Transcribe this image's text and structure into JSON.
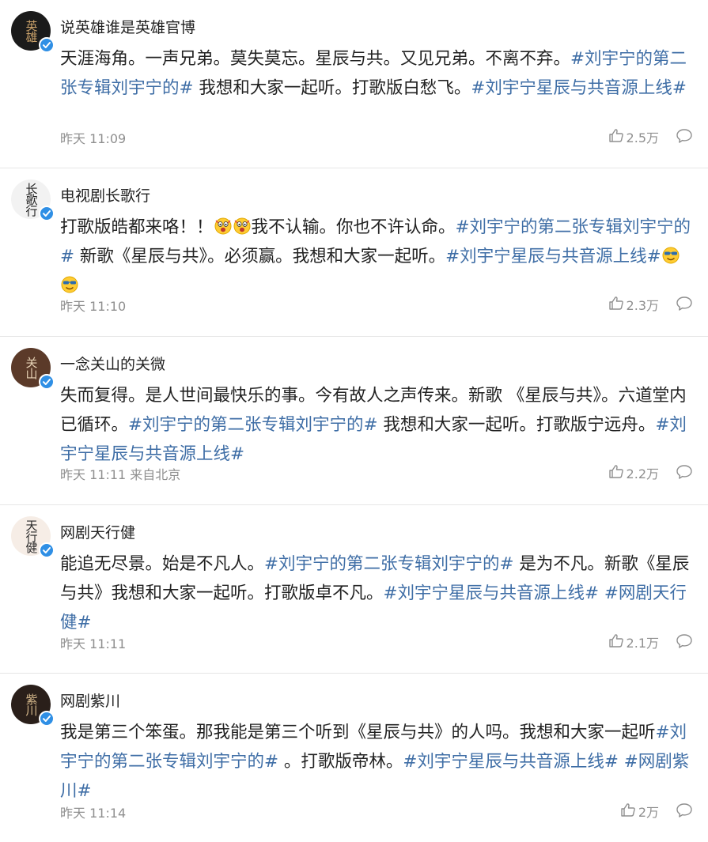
{
  "colors": {
    "hashtag": "#3f6ea6",
    "meta": "#8f8f8f",
    "verified_badge": "#2f8fe5",
    "divider": "#e6e6e6"
  },
  "posts": [
    {
      "username": "说英雄谁是英雄官博",
      "avatar_text": "英雄",
      "avatar_bg": "#1b1b1b",
      "avatar_fg": "#c9a16a",
      "verified": true,
      "content": [
        {
          "type": "text",
          "value": "天涯海角。一声兄弟。莫失莫忘。星辰与共。又见兄弟。不离不弃。"
        },
        {
          "type": "tag",
          "value": "#刘宇宁的第二张专辑刘宇宁的#"
        },
        {
          "type": "text",
          "value": " 我想和大家一起听。打歌版白愁飞。"
        },
        {
          "type": "tag",
          "value": "#刘宇宁星辰与共音源上线#"
        }
      ],
      "time": "昨天 11:09",
      "location": "",
      "likes": "2.5万",
      "icons": {
        "like": "thumbs-up-icon",
        "comment": "comment-icon"
      }
    },
    {
      "username": "电视剧长歌行",
      "avatar_text": "长歌行",
      "avatar_bg": "#f2f2f2",
      "avatar_fg": "#222222",
      "verified": true,
      "content": [
        {
          "type": "text",
          "value": "打歌版皓都来咯！！"
        },
        {
          "type": "emoji",
          "value": "shocked-emoji"
        },
        {
          "type": "emoji",
          "value": "shocked-emoji"
        },
        {
          "type": "text",
          "value": "我不认输。你也不许认命。"
        },
        {
          "type": "tag",
          "value": "#刘宇宁的第二张专辑刘宇宁的#"
        },
        {
          "type": "text",
          "value": " 新歌《星辰与共》。必须赢。我想和大家一起听。"
        },
        {
          "type": "tag",
          "value": "#刘宇宁星辰与共音源上线#"
        },
        {
          "type": "emoji",
          "value": "cool-emoji"
        },
        {
          "type": "emoji",
          "value": "cool-emoji"
        }
      ],
      "time": "昨天 11:10",
      "location": "",
      "likes": "2.3万",
      "icons": {
        "like": "thumbs-up-icon",
        "comment": "comment-icon"
      }
    },
    {
      "username": "一念关山的关微",
      "avatar_text": "关山",
      "avatar_bg": "#5b3a29",
      "avatar_fg": "#e7d2b5",
      "verified": true,
      "content": [
        {
          "type": "text",
          "value": "失而复得。是人世间最快乐的事。今有故人之声传来。新歌 《星辰与共》。六道堂内已循环。"
        },
        {
          "type": "tag",
          "value": "#刘宇宁的第二张专辑刘宇宁的#"
        },
        {
          "type": "text",
          "value": " 我想和大家一起听。打歌版宁远舟。"
        },
        {
          "type": "tag",
          "value": "#刘宇宁星辰与共音源上线#"
        }
      ],
      "time": "昨天 11:11",
      "location": "来自北京",
      "likes": "2.2万",
      "icons": {
        "like": "thumbs-up-icon",
        "comment": "comment-icon"
      }
    },
    {
      "username": "网剧天行健",
      "avatar_text": "天行健",
      "avatar_bg": "#f6ede6",
      "avatar_fg": "#2a2a2a",
      "verified": true,
      "content": [
        {
          "type": "text",
          "value": "能追无尽景。始是不凡人。"
        },
        {
          "type": "tag",
          "value": "#刘宇宁的第二张专辑刘宇宁的#"
        },
        {
          "type": "text",
          "value": " 是为不凡。新歌《星辰与共》我想和大家一起听。打歌版卓不凡。"
        },
        {
          "type": "tag",
          "value": "#刘宇宁星辰与共音源上线#"
        },
        {
          "type": "text",
          "value": " "
        },
        {
          "type": "tag",
          "value": "#网剧天行健#"
        }
      ],
      "time": "昨天 11:11",
      "location": "",
      "likes": "2.1万",
      "icons": {
        "like": "thumbs-up-icon",
        "comment": "comment-icon"
      }
    },
    {
      "username": "网剧紫川",
      "avatar_text": "紫川",
      "avatar_bg": "#2a1f1a",
      "avatar_fg": "#d6b98c",
      "verified": true,
      "content": [
        {
          "type": "text",
          "value": "我是第三个笨蛋。那我能是第三个听到《星辰与共》的人吗。我想和大家一起听"
        },
        {
          "type": "tag",
          "value": "#刘宇宁的第二张专辑刘宇宁的#"
        },
        {
          "type": "text",
          "value": " 。打歌版帝林。"
        },
        {
          "type": "tag",
          "value": "#刘宇宁星辰与共音源上线#"
        },
        {
          "type": "text",
          "value": " "
        },
        {
          "type": "tag",
          "value": "#网剧紫川#"
        }
      ],
      "time": "昨天 11:14",
      "location": "",
      "likes": "2万",
      "icons": {
        "like": "thumbs-up-icon",
        "comment": "comment-icon"
      }
    }
  ]
}
